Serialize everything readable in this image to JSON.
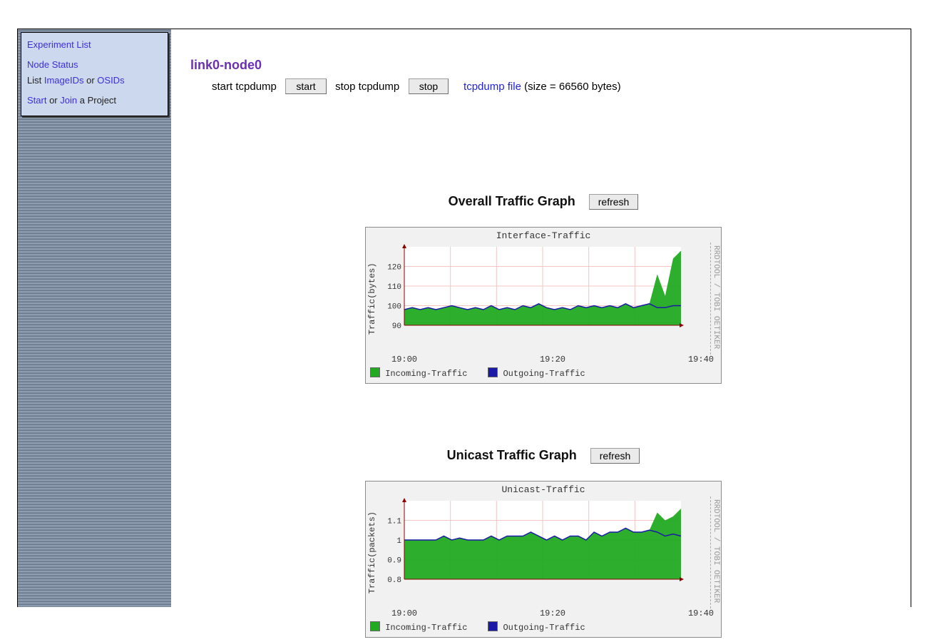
{
  "sidebar": {
    "items": [
      {
        "label": "Experiment List",
        "type": "link"
      },
      {
        "label": "Node Status",
        "type": "link"
      },
      {
        "label": "List ",
        "type": "text"
      },
      {
        "label": "ImageIDs",
        "type": "link"
      },
      {
        "label": " or ",
        "type": "text"
      },
      {
        "label": "OSIDs",
        "type": "link"
      },
      {
        "label": "Start",
        "type": "link"
      },
      {
        "label": " or ",
        "type": "text"
      },
      {
        "label": "Join",
        "type": "link"
      },
      {
        "label": " a Project",
        "type": "text"
      }
    ],
    "row1": "Experiment List",
    "row2": "Node Status",
    "row3_pre": "List ",
    "row3_link1": "ImageIDs",
    "row3_mid": " or ",
    "row3_link2": "OSIDs",
    "row4_link1": "Start",
    "row4_mid": " or ",
    "row4_link2": "Join",
    "row4_tail": " a Project"
  },
  "header": {
    "title": "link0-node0",
    "start_label": "start tcpdump",
    "start_btn": "start",
    "stop_label": "stop tcpdump",
    "stop_btn": "stop",
    "file_link": "tcpdump file",
    "file_note": "(size = 66560 bytes)"
  },
  "section1": {
    "title": "Overall Traffic Graph",
    "refresh": "refresh"
  },
  "section2": {
    "title": "Unicast Traffic Graph",
    "refresh": "refresh"
  },
  "chart_data": [
    {
      "type": "area-line",
      "title": "Interface-Traffic",
      "ylabel": "Traffic(bytes)",
      "ylim": [
        90,
        130
      ],
      "yticks": [
        90,
        100,
        110,
        120
      ],
      "xticks": [
        "19:00",
        "19:20",
        "19:40"
      ],
      "x": [
        "18:40",
        "18:42",
        "18:44",
        "18:46",
        "18:48",
        "18:50",
        "18:52",
        "18:54",
        "18:56",
        "18:58",
        "19:00",
        "19:02",
        "19:04",
        "19:06",
        "19:08",
        "19:10",
        "19:12",
        "19:14",
        "19:16",
        "19:18",
        "19:20",
        "19:22",
        "19:24",
        "19:26",
        "19:28",
        "19:30",
        "19:32",
        "19:34",
        "19:36",
        "19:38",
        "19:40",
        "19:42",
        "19:44",
        "19:46",
        "19:48",
        "19:50"
      ],
      "series": [
        {
          "name": "Incoming-Traffic",
          "style": "area",
          "color": "#22aa22",
          "values": [
            98,
            99,
            98,
            99,
            98,
            99,
            100,
            99,
            98,
            99,
            98,
            100,
            98,
            99,
            98,
            100,
            99,
            101,
            99,
            98,
            99,
            98,
            100,
            99,
            100,
            99,
            100,
            99,
            101,
            99,
            100,
            101,
            116,
            105,
            124,
            128
          ]
        },
        {
          "name": "Outgoing-Traffic",
          "style": "line",
          "color": "#1a1aa6",
          "values": [
            98,
            99,
            98,
            99,
            98,
            99,
            100,
            99,
            98,
            99,
            98,
            100,
            98,
            99,
            98,
            100,
            99,
            101,
            99,
            98,
            99,
            98,
            100,
            99,
            100,
            99,
            100,
            99,
            101,
            99,
            100,
            101,
            99,
            99,
            100,
            100
          ]
        }
      ],
      "legend": [
        "Incoming-Traffic",
        "Outgoing-Traffic"
      ],
      "credit": "RRDTOOL / TOBI OETIKER"
    },
    {
      "type": "area-line",
      "title": "Unicast-Traffic",
      "ylabel": "Traffic(packets)",
      "ylim": [
        0.8,
        1.2
      ],
      "yticks": [
        0.8,
        0.9,
        1.0,
        1.1
      ],
      "xticks": [
        "19:00",
        "19:20",
        "19:40"
      ],
      "x": [
        "18:40",
        "18:42",
        "18:44",
        "18:46",
        "18:48",
        "18:50",
        "18:52",
        "18:54",
        "18:56",
        "18:58",
        "19:00",
        "19:02",
        "19:04",
        "19:06",
        "19:08",
        "19:10",
        "19:12",
        "19:14",
        "19:16",
        "19:18",
        "19:20",
        "19:22",
        "19:24",
        "19:26",
        "19:28",
        "19:30",
        "19:32",
        "19:34",
        "19:36",
        "19:38",
        "19:40",
        "19:42",
        "19:44",
        "19:46",
        "19:48",
        "19:50"
      ],
      "series": [
        {
          "name": "Incoming-Traffic",
          "style": "area",
          "color": "#22aa22",
          "values": [
            1.0,
            1.0,
            1.0,
            1.0,
            1.0,
            1.02,
            1.0,
            1.01,
            1.0,
            1.0,
            1.0,
            1.02,
            1.0,
            1.02,
            1.02,
            1.02,
            1.04,
            1.02,
            1.0,
            1.02,
            1.0,
            1.02,
            1.02,
            1.0,
            1.04,
            1.02,
            1.04,
            1.04,
            1.06,
            1.04,
            1.04,
            1.05,
            1.14,
            1.1,
            1.12,
            1.16
          ]
        },
        {
          "name": "Outgoing-Traffic",
          "style": "line",
          "color": "#1a1aa6",
          "values": [
            1.0,
            1.0,
            1.0,
            1.0,
            1.0,
            1.02,
            1.0,
            1.01,
            1.0,
            1.0,
            1.0,
            1.02,
            1.0,
            1.02,
            1.02,
            1.02,
            1.04,
            1.02,
            1.0,
            1.02,
            1.0,
            1.02,
            1.02,
            1.0,
            1.04,
            1.02,
            1.04,
            1.04,
            1.06,
            1.04,
            1.04,
            1.05,
            1.04,
            1.02,
            1.03,
            1.02
          ]
        }
      ],
      "legend": [
        "Incoming-Traffic",
        "Outgoing-Traffic"
      ],
      "credit": "RRDTOOL / TOBI OETIKER"
    }
  ]
}
